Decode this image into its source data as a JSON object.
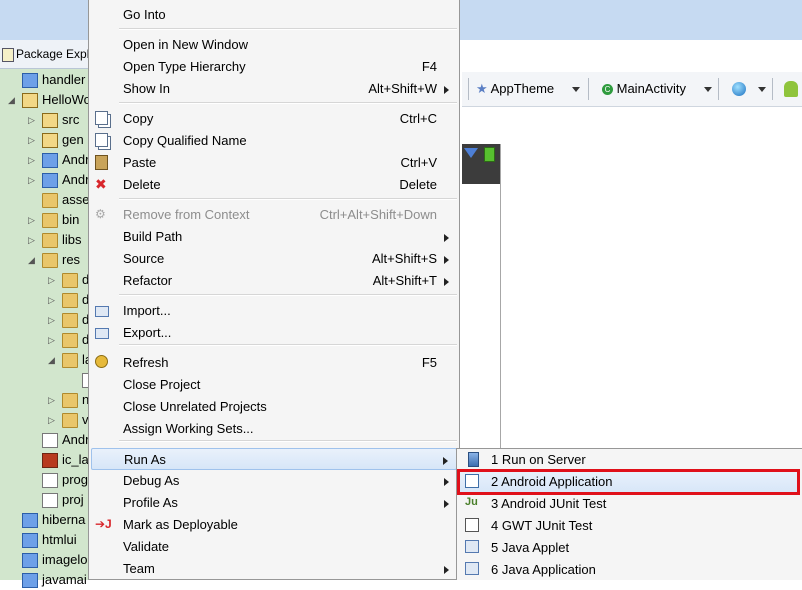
{
  "explorer": {
    "title": "Package Expl",
    "rows": [
      {
        "label": "handler",
        "arrow": "",
        "icon": "blue"
      },
      {
        "label": "HelloWo",
        "arrow": "◢",
        "icon": "proj"
      },
      {
        "label": "src",
        "arrow": "▷",
        "icon": "pkg"
      },
      {
        "label": "gen",
        "arrow": "▷",
        "icon": "pkg"
      },
      {
        "label": "Andr",
        "arrow": "▷",
        "icon": "blue"
      },
      {
        "label": "Andr",
        "arrow": "▷",
        "icon": "blue"
      },
      {
        "label": "asse",
        "arrow": "",
        "icon": "folder"
      },
      {
        "label": "bin",
        "arrow": "▷",
        "icon": "folder"
      },
      {
        "label": "libs",
        "arrow": "▷",
        "icon": "folder"
      },
      {
        "label": "res",
        "arrow": "◢",
        "icon": "folder"
      },
      {
        "label": "d",
        "arrow": "▷",
        "icon": "folder"
      },
      {
        "label": "d",
        "arrow": "▷",
        "icon": "folder"
      },
      {
        "label": "d",
        "arrow": "▷",
        "icon": "folder"
      },
      {
        "label": "d",
        "arrow": "▷",
        "icon": "folder"
      },
      {
        "label": "la",
        "arrow": "◢",
        "icon": "folder"
      },
      {
        "label": "",
        "arrow": "",
        "icon": "file"
      },
      {
        "label": "n",
        "arrow": "▷",
        "icon": "folder"
      },
      {
        "label": "v",
        "arrow": "▷",
        "icon": "folder"
      },
      {
        "label": "Andr",
        "arrow": "",
        "icon": "file"
      },
      {
        "label": "ic_la",
        "arrow": "",
        "icon": "img"
      },
      {
        "label": "prog",
        "arrow": "",
        "icon": "file"
      },
      {
        "label": "proj",
        "arrow": "",
        "icon": "file"
      },
      {
        "label": "hiberna",
        "arrow": "",
        "icon": "blue"
      },
      {
        "label": "htmlui",
        "arrow": "",
        "icon": "blue"
      },
      {
        "label": "imagelo",
        "arrow": "",
        "icon": "blue"
      },
      {
        "label": "javamai",
        "arrow": "",
        "icon": "blue"
      }
    ]
  },
  "toolbar": {
    "theme": "AppTheme",
    "activity": "MainActivity"
  },
  "menu": {
    "items": [
      {
        "label": "Go Into",
        "shortcut": "",
        "sub": false,
        "icon": "",
        "disabled": false
      },
      {
        "label": "Open in New Window",
        "shortcut": "",
        "sub": false,
        "icon": "",
        "disabled": false
      },
      {
        "label": "Open Type Hierarchy",
        "shortcut": "F4",
        "sub": false,
        "icon": "",
        "disabled": false
      },
      {
        "label": "Show In",
        "shortcut": "Alt+Shift+W",
        "sub": true,
        "icon": "",
        "disabled": false
      },
      {
        "label": "Copy",
        "shortcut": "Ctrl+C",
        "sub": false,
        "icon": "copy",
        "disabled": false
      },
      {
        "label": "Copy Qualified Name",
        "shortcut": "",
        "sub": false,
        "icon": "copy",
        "disabled": false
      },
      {
        "label": "Paste",
        "shortcut": "Ctrl+V",
        "sub": false,
        "icon": "paste",
        "disabled": false
      },
      {
        "label": "Delete",
        "shortcut": "Delete",
        "sub": false,
        "icon": "delete",
        "disabled": false
      },
      {
        "label": "Remove from Context",
        "shortcut": "Ctrl+Alt+Shift+Down",
        "sub": false,
        "icon": "remove",
        "disabled": true
      },
      {
        "label": "Build Path",
        "shortcut": "",
        "sub": true,
        "icon": "",
        "disabled": false
      },
      {
        "label": "Source",
        "shortcut": "Alt+Shift+S",
        "sub": true,
        "icon": "",
        "disabled": false
      },
      {
        "label": "Refactor",
        "shortcut": "Alt+Shift+T",
        "sub": true,
        "icon": "",
        "disabled": false
      },
      {
        "label": "Import...",
        "shortcut": "",
        "sub": false,
        "icon": "import",
        "disabled": false
      },
      {
        "label": "Export...",
        "shortcut": "",
        "sub": false,
        "icon": "export",
        "disabled": false
      },
      {
        "label": "Refresh",
        "shortcut": "F5",
        "sub": false,
        "icon": "refresh",
        "disabled": false
      },
      {
        "label": "Close Project",
        "shortcut": "",
        "sub": false,
        "icon": "",
        "disabled": false
      },
      {
        "label": "Close Unrelated Projects",
        "shortcut": "",
        "sub": false,
        "icon": "",
        "disabled": false
      },
      {
        "label": "Assign Working Sets...",
        "shortcut": "",
        "sub": false,
        "icon": "",
        "disabled": false
      },
      {
        "label": "Run As",
        "shortcut": "",
        "sub": true,
        "icon": "",
        "disabled": false
      },
      {
        "label": "Debug As",
        "shortcut": "",
        "sub": true,
        "icon": "",
        "disabled": false
      },
      {
        "label": "Profile As",
        "shortcut": "",
        "sub": true,
        "icon": "",
        "disabled": false
      },
      {
        "label": "Mark as Deployable",
        "shortcut": "",
        "sub": false,
        "icon": "deploy",
        "disabled": false
      },
      {
        "label": "Validate",
        "shortcut": "",
        "sub": false,
        "icon": "",
        "disabled": false
      },
      {
        "label": "Team",
        "shortcut": "",
        "sub": true,
        "icon": "",
        "disabled": false
      }
    ]
  },
  "submenu": {
    "items": [
      {
        "label": "1 Run on Server",
        "icon": "server"
      },
      {
        "label": "2 Android Application",
        "icon": "android-app"
      },
      {
        "label": "3 Android JUnit Test",
        "icon": "junit"
      },
      {
        "label": "4 GWT JUnit Test",
        "icon": "gwt"
      },
      {
        "label": "5 Java Applet",
        "icon": "applet"
      },
      {
        "label": "6 Java Application",
        "icon": "java-app"
      }
    ]
  },
  "colors": {
    "highlight_border": "#e0101a",
    "hover_bg": "#d7e6f8",
    "explorer_bg": "#d2e6cd"
  }
}
